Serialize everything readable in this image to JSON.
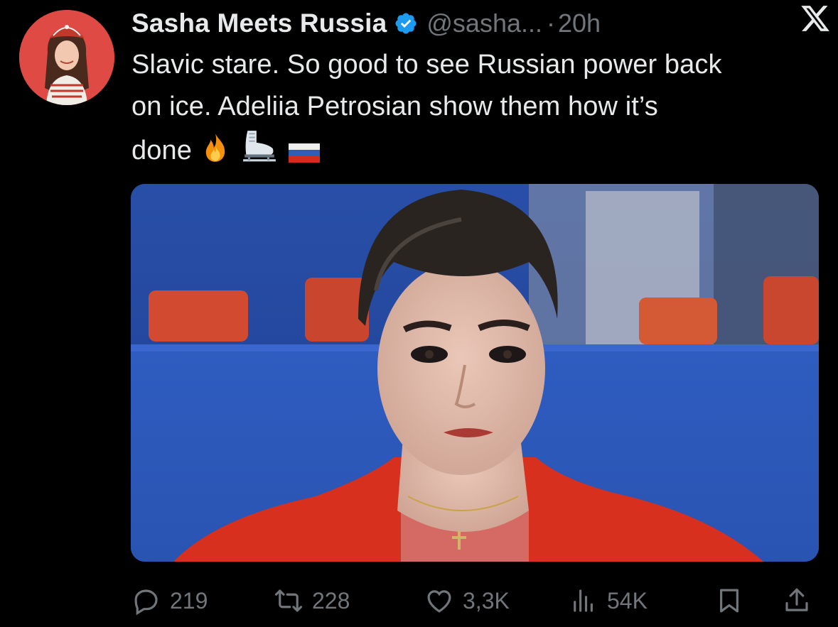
{
  "author": {
    "display_name": "Sasha Meets Russia",
    "handle": "@sasha...",
    "separator": "·",
    "time": "20h",
    "verified_color": "#1d9bf0"
  },
  "tweet": {
    "line1": "Slavic stare. So good to see Russian power back",
    "line2": "on ice. Adeliia Petrosian show them how it’s",
    "line3": "done"
  },
  "media": {
    "description": "figure skater in red sequined costume"
  },
  "actions": {
    "replies": "219",
    "retweets": "228",
    "likes": "3,3K",
    "views": "54K"
  },
  "icons": [
    "x-logo-icon",
    "verified-badge-icon",
    "fire-emoji-icon",
    "ice-skate-emoji-icon",
    "russia-flag-emoji-icon",
    "reply-icon",
    "retweet-icon",
    "like-icon",
    "views-icon",
    "bookmark-icon",
    "share-icon"
  ]
}
